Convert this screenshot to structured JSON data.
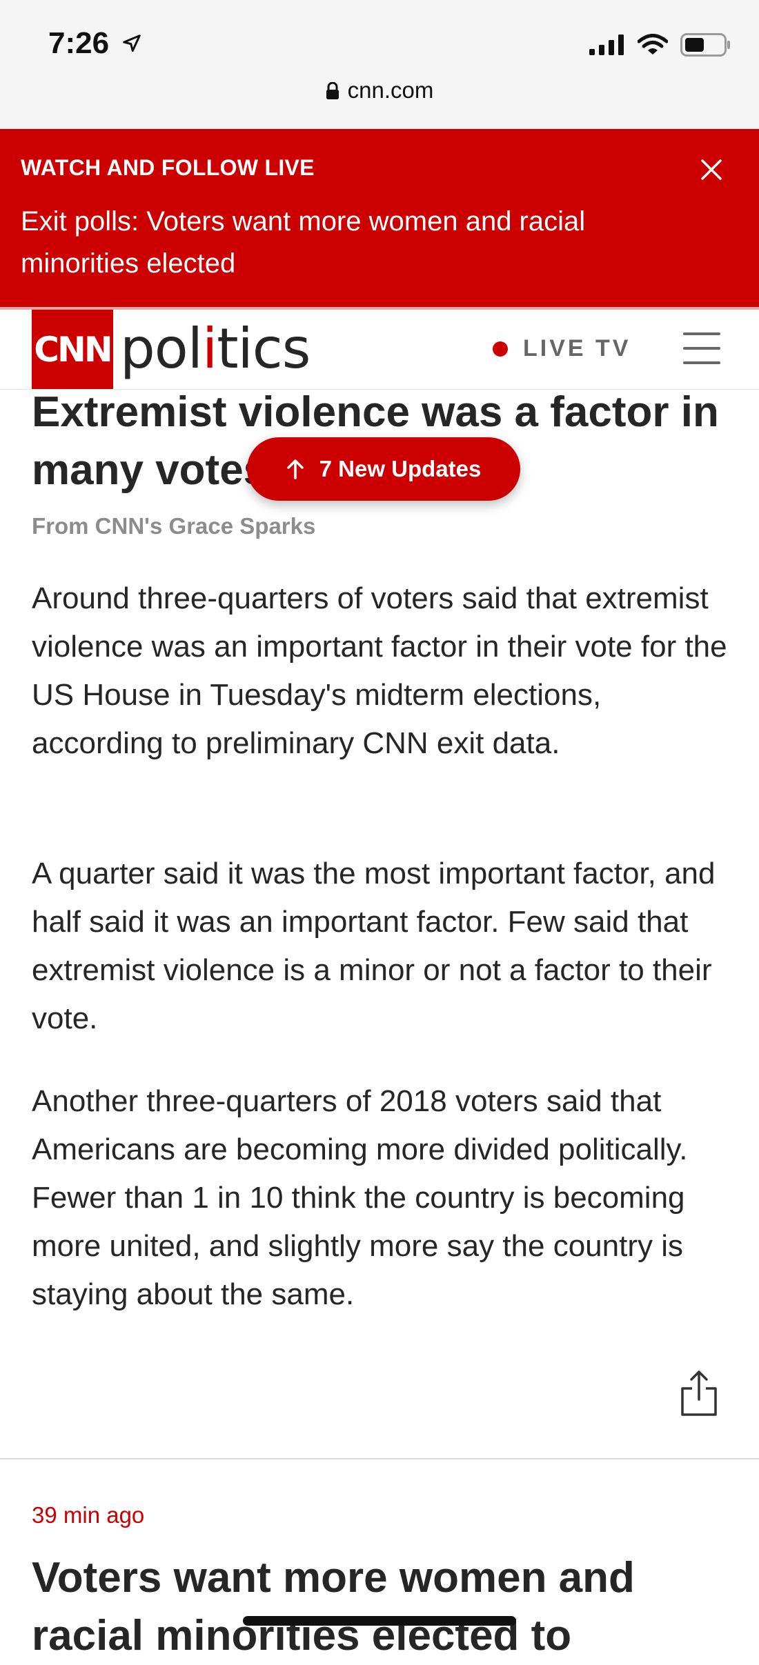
{
  "status_bar": {
    "time": "7:26",
    "icons": [
      "location-arrow-icon",
      "signal-icon",
      "wifi-icon",
      "battery-icon"
    ]
  },
  "url_bar": {
    "url": "cnn.com",
    "icon": "lock-icon"
  },
  "banner": {
    "kicker": "WATCH AND FOLLOW LIVE",
    "headline": "Exit polls: Voters want more women and racial minorities elected",
    "close_icon": "close-icon",
    "bg_color": "#cc0000"
  },
  "nav": {
    "logo_text": "CNN",
    "section_pre": "pol",
    "section_i": "i",
    "section_post": "tics",
    "live_label": "LIVE TV",
    "menu_icon": "hamburger-menu-icon"
  },
  "article": {
    "headline": "Extremist violence was a factor in many votes",
    "updates_label": "7 New Updates",
    "byline": "From CNN's Grace Sparks",
    "paragraphs": [
      "Around three-quarters of voters said that extremist violence was an important factor in their vote for the US House in Tuesday's midterm elections, according to preliminary CNN exit data.",
      "A quarter said it was the most important factor, and half said it was an important factor. Few said that extremist violence is a minor or not a factor to their vote.",
      "Another three-quarters of 2018 voters said that Americans are becoming more divided politically. Fewer than 1 in 10 think the country is becoming more united, and slightly more say the country is staying about the same."
    ],
    "share_icon": "share-icon"
  },
  "next_post": {
    "timestamp": "39 min ago",
    "headline": "Voters want more women and racial minorities elected to"
  },
  "colors": {
    "accent": "#cc0000",
    "text": "#262626",
    "muted": "#8c8c8c"
  }
}
